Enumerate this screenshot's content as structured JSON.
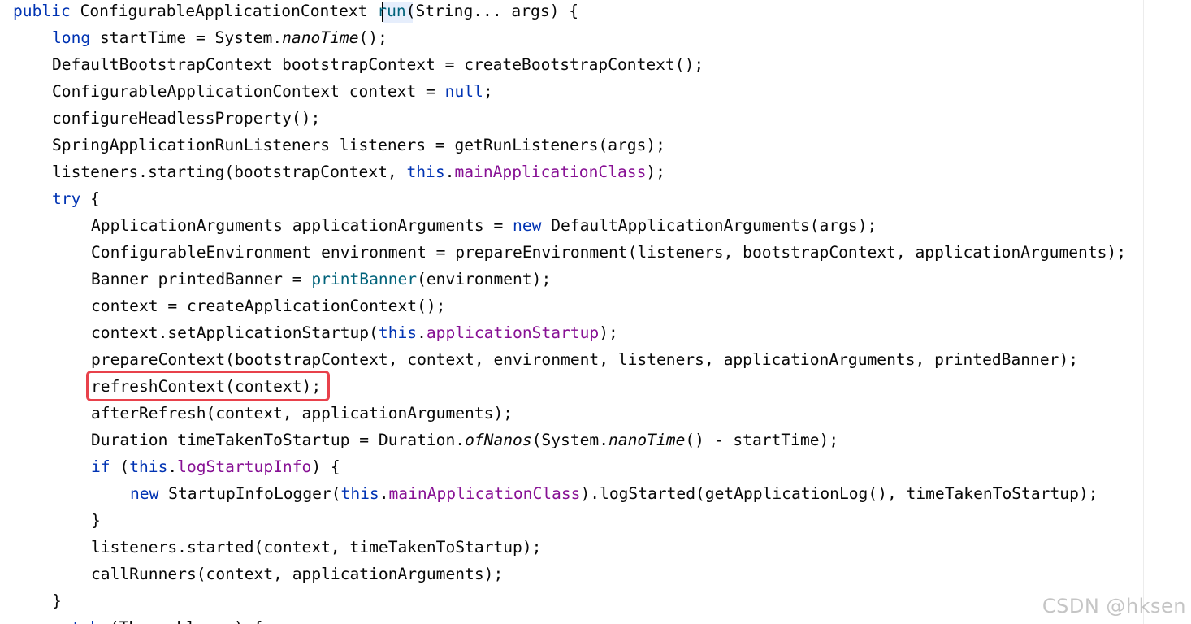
{
  "editor": {
    "colors": {
      "keyword": "#0033b3",
      "field": "#871094",
      "method_declaration": "#00627a",
      "plain": "#080808",
      "highlight_box": "#e8414b"
    },
    "lines": [
      {
        "indent": 0,
        "tokens": [
          {
            "t": "public",
            "c": "kw"
          },
          {
            "t": " ConfigurableApplicationContext ",
            "c": "plain"
          },
          {
            "t": "run",
            "c": "method-decl"
          },
          {
            "t": "(String... args) {",
            "c": "plain"
          }
        ]
      },
      {
        "indent": 1,
        "tokens": [
          {
            "t": "long",
            "c": "kw"
          },
          {
            "t": " startTime = System.",
            "c": "plain"
          },
          {
            "t": "nanoTime",
            "c": "italic"
          },
          {
            "t": "();",
            "c": "plain"
          }
        ]
      },
      {
        "indent": 1,
        "tokens": [
          {
            "t": "DefaultBootstrapContext bootstrapContext = createBootstrapContext();",
            "c": "plain"
          }
        ]
      },
      {
        "indent": 1,
        "tokens": [
          {
            "t": "ConfigurableApplicationContext context = ",
            "c": "plain"
          },
          {
            "t": "null",
            "c": "kw"
          },
          {
            "t": ";",
            "c": "plain"
          }
        ]
      },
      {
        "indent": 1,
        "tokens": [
          {
            "t": "configureHeadlessProperty();",
            "c": "plain"
          }
        ]
      },
      {
        "indent": 1,
        "tokens": [
          {
            "t": "SpringApplicationRunListeners listeners = getRunListeners(args);",
            "c": "plain"
          }
        ]
      },
      {
        "indent": 1,
        "tokens": [
          {
            "t": "listeners.starting(bootstrapContext, ",
            "c": "plain"
          },
          {
            "t": "this",
            "c": "kw"
          },
          {
            "t": ".",
            "c": "plain"
          },
          {
            "t": "mainApplicationClass",
            "c": "field"
          },
          {
            "t": ");",
            "c": "plain"
          }
        ]
      },
      {
        "indent": 1,
        "tokens": [
          {
            "t": "try",
            "c": "kw"
          },
          {
            "t": " {",
            "c": "plain"
          }
        ]
      },
      {
        "indent": 2,
        "tokens": [
          {
            "t": "ApplicationArguments applicationArguments = ",
            "c": "plain"
          },
          {
            "t": "new",
            "c": "kw"
          },
          {
            "t": " DefaultApplicationArguments(args);",
            "c": "plain"
          }
        ]
      },
      {
        "indent": 2,
        "tokens": [
          {
            "t": "ConfigurableEnvironment environment = prepareEnvironment(listeners, bootstrapContext, applicationArguments);",
            "c": "plain"
          }
        ]
      },
      {
        "indent": 2,
        "tokens": [
          {
            "t": "Banner printedBanner = ",
            "c": "plain"
          },
          {
            "t": "printBanner",
            "c": "method-decl"
          },
          {
            "t": "(environment);",
            "c": "plain"
          }
        ]
      },
      {
        "indent": 2,
        "tokens": [
          {
            "t": "context = createApplicationContext();",
            "c": "plain"
          }
        ]
      },
      {
        "indent": 2,
        "tokens": [
          {
            "t": "context.setApplicationStartup(",
            "c": "plain"
          },
          {
            "t": "this",
            "c": "kw"
          },
          {
            "t": ".",
            "c": "plain"
          },
          {
            "t": "applicationStartup",
            "c": "field"
          },
          {
            "t": ");",
            "c": "plain"
          }
        ]
      },
      {
        "indent": 2,
        "tokens": [
          {
            "t": "prepareContext(bootstrapContext, context, environment, listeners, applicationArguments, printedBanner);",
            "c": "plain"
          }
        ]
      },
      {
        "indent": 2,
        "tokens": [
          {
            "t": "refreshContext(context);",
            "c": "plain"
          }
        ]
      },
      {
        "indent": 2,
        "tokens": [
          {
            "t": "afterRefresh(context, applicationArguments);",
            "c": "plain"
          }
        ]
      },
      {
        "indent": 2,
        "tokens": [
          {
            "t": "Duration timeTakenToStartup = Duration.",
            "c": "plain"
          },
          {
            "t": "ofNanos",
            "c": "italic"
          },
          {
            "t": "(System.",
            "c": "plain"
          },
          {
            "t": "nanoTime",
            "c": "italic"
          },
          {
            "t": "() - startTime);",
            "c": "plain"
          }
        ]
      },
      {
        "indent": 2,
        "tokens": [
          {
            "t": "if",
            "c": "kw"
          },
          {
            "t": " (",
            "c": "plain"
          },
          {
            "t": "this",
            "c": "kw"
          },
          {
            "t": ".",
            "c": "plain"
          },
          {
            "t": "logStartupInfo",
            "c": "field"
          },
          {
            "t": ") {",
            "c": "plain"
          }
        ]
      },
      {
        "indent": 3,
        "tokens": [
          {
            "t": "new",
            "c": "kw"
          },
          {
            "t": " StartupInfoLogger(",
            "c": "plain"
          },
          {
            "t": "this",
            "c": "kw"
          },
          {
            "t": ".",
            "c": "plain"
          },
          {
            "t": "mainApplicationClass",
            "c": "field"
          },
          {
            "t": ").logStarted(getApplicationLog(), timeTakenToStartup);",
            "c": "plain"
          }
        ]
      },
      {
        "indent": 2,
        "tokens": [
          {
            "t": "}",
            "c": "plain"
          }
        ]
      },
      {
        "indent": 2,
        "tokens": [
          {
            "t": "listeners.started(context, timeTakenToStartup);",
            "c": "plain"
          }
        ]
      },
      {
        "indent": 2,
        "tokens": [
          {
            "t": "callRunners(context, applicationArguments);",
            "c": "plain"
          }
        ]
      },
      {
        "indent": 1,
        "tokens": [
          {
            "t": "}",
            "c": "plain"
          }
        ]
      },
      {
        "indent": 1,
        "tokens": [
          {
            "t": "catch",
            "c": "kw"
          },
          {
            "t": " (Throwable ex) {",
            "c": "plain"
          }
        ]
      }
    ],
    "highlighted_line_text": "refreshContext(context);"
  },
  "watermark": {
    "text": "CSDN @hksen"
  }
}
